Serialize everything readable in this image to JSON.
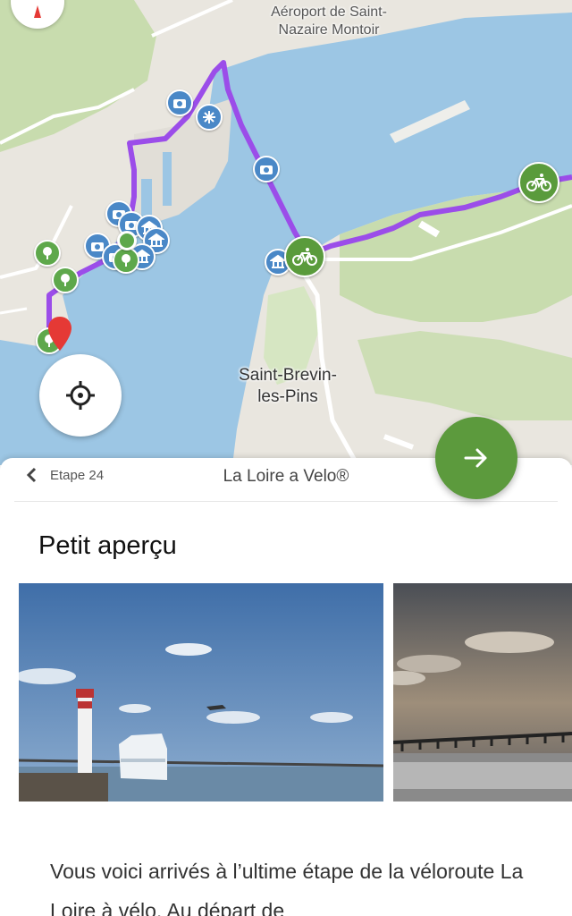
{
  "map": {
    "labels": {
      "airport": "Aéroport de Saint-Nazaire Montoir",
      "town": "Saint-Brevin-les-Pins"
    },
    "icons": {
      "compass": "compass-icon",
      "locate": "crosshair-icon",
      "poi_camera": "camera-icon",
      "poi_museum": "museum-icon",
      "poi_tree": "tree-icon",
      "poi_snow": "snowflake-icon",
      "bike": "bike-icon",
      "pin": "location-pin-icon"
    },
    "colors": {
      "water": "#9cc6e4",
      "land": "#e9e6df",
      "green": "#c8dcae",
      "route": "#9b4de9",
      "poi_blue": "#4a88c7",
      "poi_green": "#5ea84b",
      "bike": "#5a9b3c"
    }
  },
  "fab": {
    "icon": "arrow-right-icon",
    "color": "#5c9a3d"
  },
  "sheet": {
    "back_label": "Etape 24",
    "title": "La Loire a Velo®",
    "section_title": "Petit aperçu",
    "description": "Vous voici arrivés à l’ultime étape de la véloroute La Loire à vélo. Au départ de"
  }
}
